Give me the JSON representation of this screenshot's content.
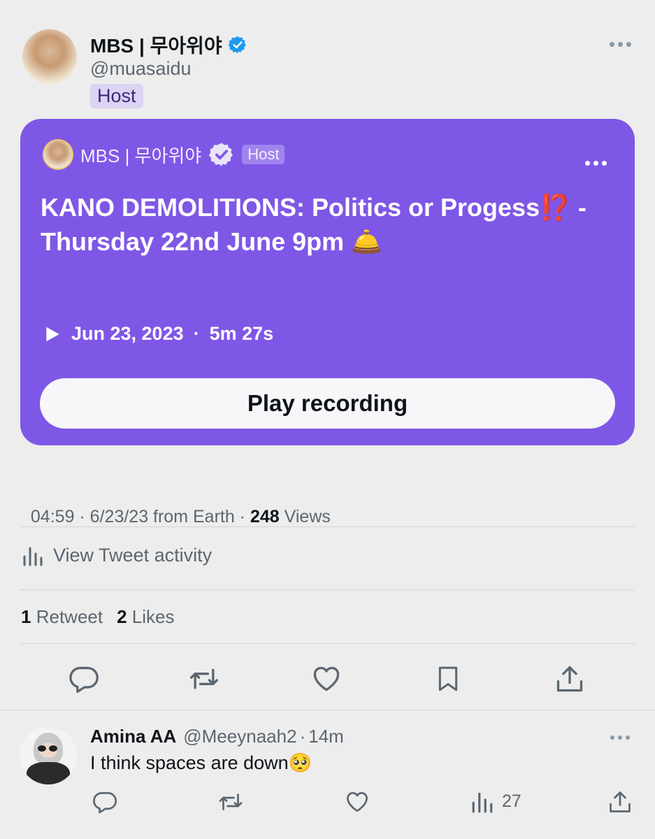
{
  "tweet": {
    "author_name": "MBS | 무아위야",
    "handle": "@muasaidu",
    "role_badge": "Host",
    "space": {
      "host_name": "MBS | 무아위야",
      "host_badge": "Host",
      "title": "KANO DEMOLITIONS: Politics or Progess⁉️ - Thursday 22nd June 9pm 🛎️",
      "date": "Jun 23, 2023",
      "separator": "·",
      "duration": "5m 27s",
      "play_label": "Play recording"
    },
    "meta": {
      "time_source": "04:59 · 6/23/23 from Earth · ",
      "views_count": "248",
      "views_label": " Views"
    },
    "activity_label": "View Tweet activity",
    "stats": {
      "retweets_count": "1",
      "retweets_label": "Retweet",
      "likes_count": "2",
      "likes_label": "Likes"
    },
    "actions": [
      "reply-icon",
      "retweet-icon",
      "like-icon",
      "bookmark-icon",
      "share-icon"
    ]
  },
  "reply": {
    "name": "Amina AA",
    "handle": "@Meeynaah2",
    "separator": "·",
    "time": "14m",
    "text": "I think spaces are down🥺",
    "views": "27",
    "actions": [
      "reply-icon",
      "retweet-icon",
      "like-icon",
      "views-icon",
      "share-icon"
    ]
  },
  "colors": {
    "background": "#ededed",
    "space_card": "#7f57e6",
    "verified_blue": "#1d9bf0",
    "muted_text": "#5b6670"
  }
}
